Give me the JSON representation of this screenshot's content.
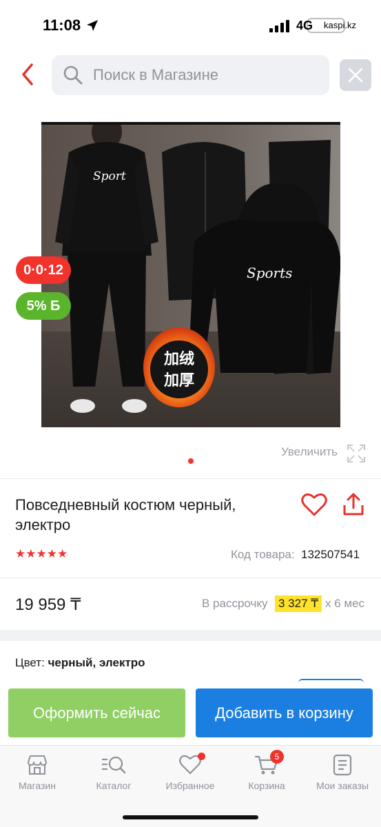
{
  "status_bar": {
    "time": "11:08",
    "network": "4G",
    "carrier_link": "kaspi.kz"
  },
  "search": {
    "placeholder": "Поиск в Магазине"
  },
  "product": {
    "badge_installment": "0·0·12",
    "badge_bonus": "5% Б",
    "zoom_label": "Увеличить",
    "title": "Повседневный костюм черный, электро",
    "rating": 5,
    "sku_label": "Код товара:",
    "sku_value": "132507541",
    "price": "19 959 ₸",
    "installment_label": "В рассрочку",
    "installment_amount": "3 327 ₸",
    "installment_term": "х 6 мес",
    "color_label": "Цвет:",
    "color_value": "черный, электро",
    "image_texts": {
      "shirt_print": "Sport",
      "hoodie_print": "Sports",
      "promo_line1": "加绒",
      "promo_line2": "加厚"
    }
  },
  "actions": {
    "buy_now": "Оформить сейчас",
    "add_to_cart": "Добавить в корзину"
  },
  "tabs": [
    {
      "label": "Магазин",
      "icon": "shop-icon"
    },
    {
      "label": "Каталог",
      "icon": "catalog-search-icon"
    },
    {
      "label": "Избранное",
      "icon": "heart-icon"
    },
    {
      "label": "Корзина",
      "icon": "cart-icon",
      "badge": "5"
    },
    {
      "label": "Мои заказы",
      "icon": "orders-icon"
    }
  ],
  "colors": {
    "accent_red": "#f1332b",
    "primary_blue": "#1a7fe0",
    "buy_green": "#8fcf63",
    "bonus_green": "#5ab52c",
    "installment_yellow": "#ffe22b"
  }
}
